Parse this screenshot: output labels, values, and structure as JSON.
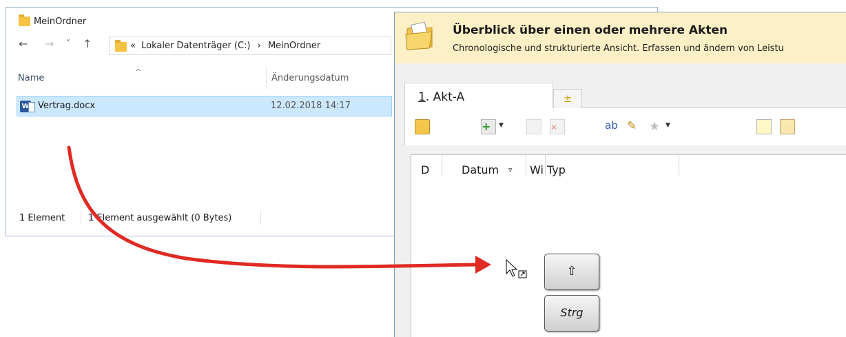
{
  "explorer": {
    "title": "MeinOrdner",
    "nav": {
      "back": "←",
      "forward": "→",
      "recent": "˅",
      "up": "↑"
    },
    "address": {
      "prefix": "«",
      "drive": "Lokaler Datenträger (C:)",
      "sep": "›",
      "folder": "MeinOrdner"
    },
    "columns": {
      "sort_glyph": "^",
      "name": "Name",
      "date": "Änderungsdatum"
    },
    "files": [
      {
        "name": "Vertrag.docx",
        "date": "12.02.2018 14:17",
        "icon": "word-doc-icon"
      }
    ],
    "status": {
      "count": "1 Element",
      "selected": "1 Element ausgewählt (0 Bytes)"
    }
  },
  "app": {
    "title": "Überblick über einen oder mehrere Akten",
    "subtitle": "Chronologische und strukturierte Ansicht. Erfassen und ändern von Leistu",
    "tabs": [
      {
        "number": "1",
        "label": ". Akt-A"
      }
    ],
    "tab_add": "±",
    "toolbar_icons": [
      "people-folder-icon",
      "add-document-icon",
      "copy-document-icon",
      "delete-document-icon",
      "search-replace-icon",
      "tools-icon",
      "star-icon",
      "note-icon",
      "email-icon"
    ],
    "grid_columns": {
      "d": "D",
      "datum": "Datum",
      "sort": "▿",
      "wi": "Wi",
      "typ": "Typ"
    }
  },
  "keys": {
    "shift": "⇧",
    "ctrl": "Strg"
  },
  "colors": {
    "arrow": "#e02a24",
    "selection": "#cce8ff",
    "header_bg": "#fdf0c6"
  }
}
